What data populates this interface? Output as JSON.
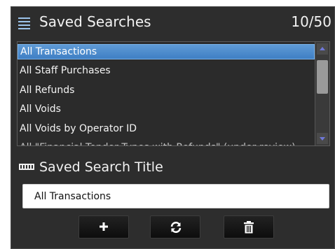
{
  "header": {
    "title": "Saved Searches",
    "count": "10/50"
  },
  "list": {
    "items": [
      "All Transactions",
      "All Staff Purchases",
      "All Refunds",
      "All Voids",
      "All Voids by Operator ID",
      "All \"Financial Tender Types with Refunds\" (under review)"
    ],
    "selected_index": 0
  },
  "title_section": {
    "label": "Saved Search Title",
    "value": "All Transactions"
  },
  "buttons": {
    "add_icon": "plus-icon",
    "refresh_icon": "refresh-icon",
    "delete_icon": "trash-icon"
  },
  "colors": {
    "panel_bg": "#2d2d2d",
    "selection": "#4a8ad0",
    "header_icon": "#9cc3ea",
    "scroll_arrow": "#6f78d8"
  }
}
